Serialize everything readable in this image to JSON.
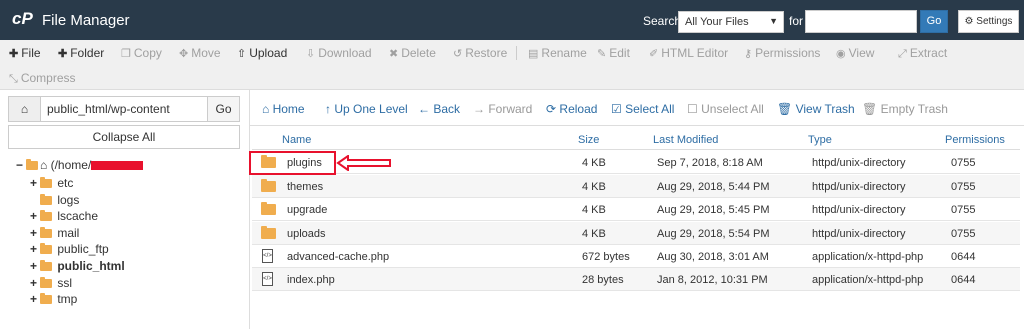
{
  "app": {
    "logo": "cP",
    "title": "File Manager"
  },
  "search": {
    "label": "Search",
    "scope": "All Your Files",
    "for_label": "for",
    "go_label": "Go",
    "settings_label": "Settings"
  },
  "toolbar": {
    "file": "File",
    "folder": "Folder",
    "copy": "Copy",
    "move": "Move",
    "upload": "Upload",
    "download": "Download",
    "delete": "Delete",
    "restore": "Restore",
    "rename": "Rename",
    "edit": "Edit",
    "html_editor": "HTML Editor",
    "permissions": "Permissions",
    "view": "View",
    "extract": "Extract",
    "compress": "Compress"
  },
  "path": {
    "value": "public_html/wp-content",
    "go_label": "Go",
    "collapse_label": "Collapse All"
  },
  "tree": {
    "root": "(/home/",
    "items": [
      "etc",
      "logs",
      "lscache",
      "mail",
      "public_ftp",
      "public_html",
      "ssl",
      "tmp"
    ]
  },
  "nav": {
    "home": "Home",
    "up": "Up One Level",
    "back": "Back",
    "forward": "Forward",
    "reload": "Reload",
    "select_all": "Select All",
    "unselect_all": "Unselect All",
    "view_trash": "View Trash",
    "empty_trash": "Empty Trash"
  },
  "table": {
    "headers": {
      "name": "Name",
      "size": "Size",
      "modified": "Last Modified",
      "type": "Type",
      "perms": "Permissions"
    },
    "rows": [
      {
        "name": "plugins",
        "size": "4 KB",
        "modified": "Sep 7, 2018, 8:18 AM",
        "type": "httpd/unix-directory",
        "perms": "0755"
      },
      {
        "name": "themes",
        "size": "4 KB",
        "modified": "Aug 29, 2018, 5:44 PM",
        "type": "httpd/unix-directory",
        "perms": "0755"
      },
      {
        "name": "upgrade",
        "size": "4 KB",
        "modified": "Aug 29, 2018, 5:45 PM",
        "type": "httpd/unix-directory",
        "perms": "0755"
      },
      {
        "name": "uploads",
        "size": "4 KB",
        "modified": "Aug 29, 2018, 5:54 PM",
        "type": "httpd/unix-directory",
        "perms": "0755"
      },
      {
        "name": "advanced-cache.php",
        "size": "672 bytes",
        "modified": "Aug 30, 2018, 3:01 AM",
        "type": "application/x-httpd-php",
        "perms": "0644"
      },
      {
        "name": "index.php",
        "size": "28 bytes",
        "modified": "Jan 8, 2012, 10:31 PM",
        "type": "application/x-httpd-php",
        "perms": "0644"
      }
    ]
  },
  "colors": {
    "topbar": "#293a4a",
    "accent": "#337ab7",
    "link": "#2e6da4",
    "folder": "#f0ad4e",
    "highlight": "#e8112d"
  }
}
